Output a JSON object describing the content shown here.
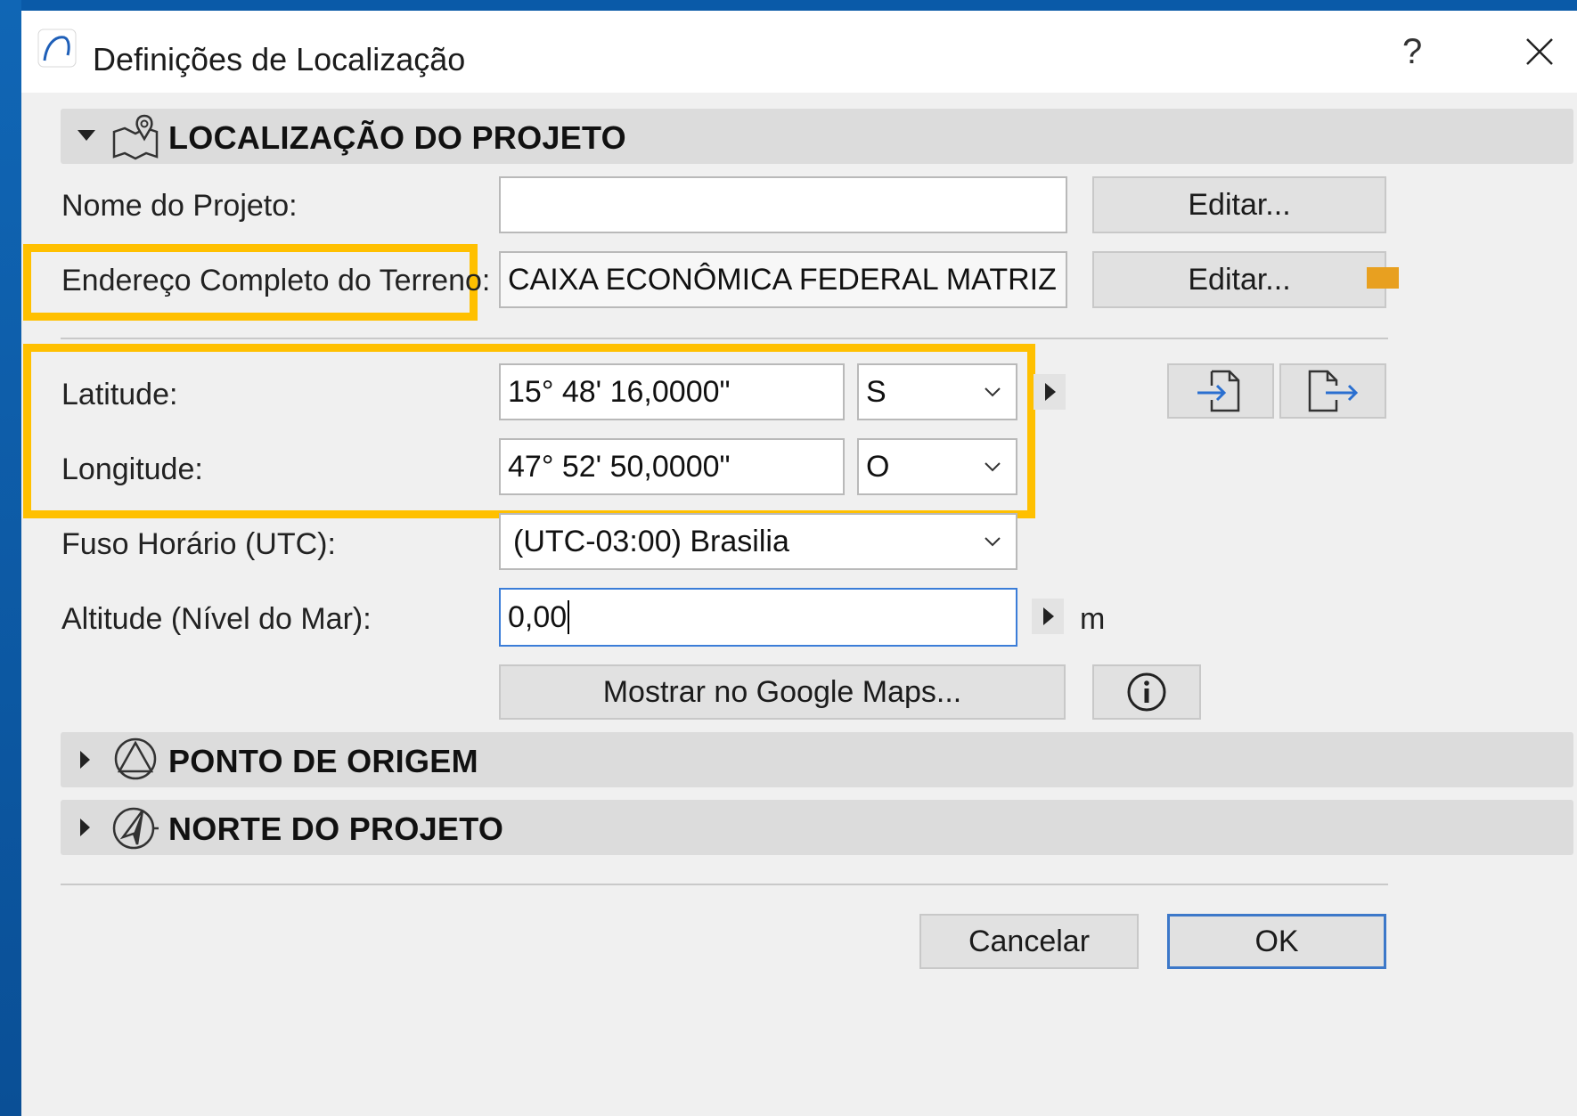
{
  "window": {
    "title": "Definições de Localização",
    "help_label": "?"
  },
  "sections": {
    "location": {
      "title": "LOCALIZAÇÃO DO PROJETO"
    },
    "origin": {
      "title": "PONTO DE ORIGEM"
    },
    "north": {
      "title": "NORTE DO PROJETO"
    }
  },
  "project_name": {
    "label": "Nome do Projeto:",
    "value": "",
    "edit_label": "Editar..."
  },
  "address": {
    "label": "Endereço Completo do Terreno:",
    "value": "CAIXA ECONÔMICA FEDERAL MATRIZ I, SBS",
    "edit_label": "Editar..."
  },
  "latitude": {
    "label": "Latitude:",
    "value": "15° 48' 16,0000\"",
    "hemisphere": "S"
  },
  "longitude": {
    "label": "Longitude:",
    "value": "47° 52' 50,0000\"",
    "hemisphere": "O"
  },
  "timezone": {
    "label": "Fuso Horário (UTC):",
    "value": "(UTC-03:00) Brasilia"
  },
  "altitude": {
    "label": "Altitude (Nível do Mar):",
    "value": "0,00",
    "unit": "m"
  },
  "google_maps": {
    "label": "Mostrar no Google Maps..."
  },
  "footer": {
    "cancel_label": "Cancelar",
    "ok_label": "OK"
  },
  "colors": {
    "highlight": "#ffc000",
    "primary_border": "#3c78c9",
    "desktop": "#0c5aa6"
  },
  "icons": [
    "app-icon",
    "close-icon",
    "map-pin-icon",
    "origin-triangle-icon",
    "compass-icon",
    "import-icon",
    "export-icon",
    "info-icon",
    "chevron-down-icon",
    "arrow-right-icon"
  ]
}
